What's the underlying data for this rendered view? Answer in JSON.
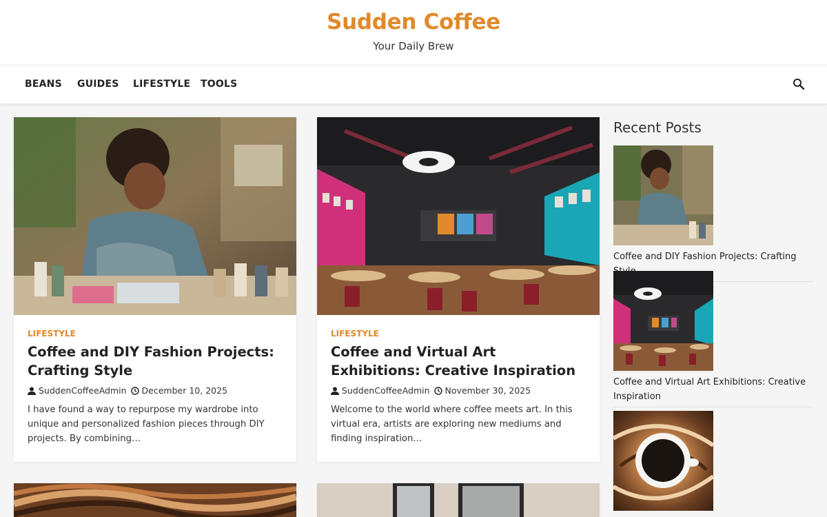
{
  "site": {
    "title": "Sudden Coffee",
    "tagline": "Your Daily Brew",
    "accent_color": "#e08a2b"
  },
  "nav": {
    "items": [
      "BEANS",
      "GUIDES",
      "LIFESTYLE",
      "TOOLS"
    ],
    "search_icon": "search-icon"
  },
  "posts": [
    {
      "category": "LIFESTYLE",
      "title": "Coffee and DIY Fashion Projects: Crafting Style",
      "author": "SuddenCoffeeAdmin",
      "date": "December 10, 2025",
      "excerpt": "I have found a way to repurpose my wardrobe into unique and personalized fashion pieces through DIY projects. By combining…",
      "image": "woman-sewing-craft-studio"
    },
    {
      "category": "LIFESTYLE",
      "title": "Coffee and Virtual Art Exhibitions: Creative Inspiration",
      "author": "SuddenCoffeeAdmin",
      "date": "November 30, 2025",
      "excerpt": "Welcome to the world where coffee meets art. In this virtual era, artists are exploring new mediums and finding inspiration…",
      "image": "art-gallery-cafe-interior"
    }
  ],
  "sidebar": {
    "heading": "Recent Posts",
    "recent_posts": [
      {
        "title": "Coffee and DIY Fashion Projects: Crafting Style",
        "image": "woman-sewing-craft-studio"
      },
      {
        "title": "Coffee and Virtual Art Exhibitions: Creative Inspiration",
        "image": "art-gallery-cafe-interior"
      },
      {
        "title": "",
        "image": "coffee-cup-swirl"
      }
    ]
  }
}
